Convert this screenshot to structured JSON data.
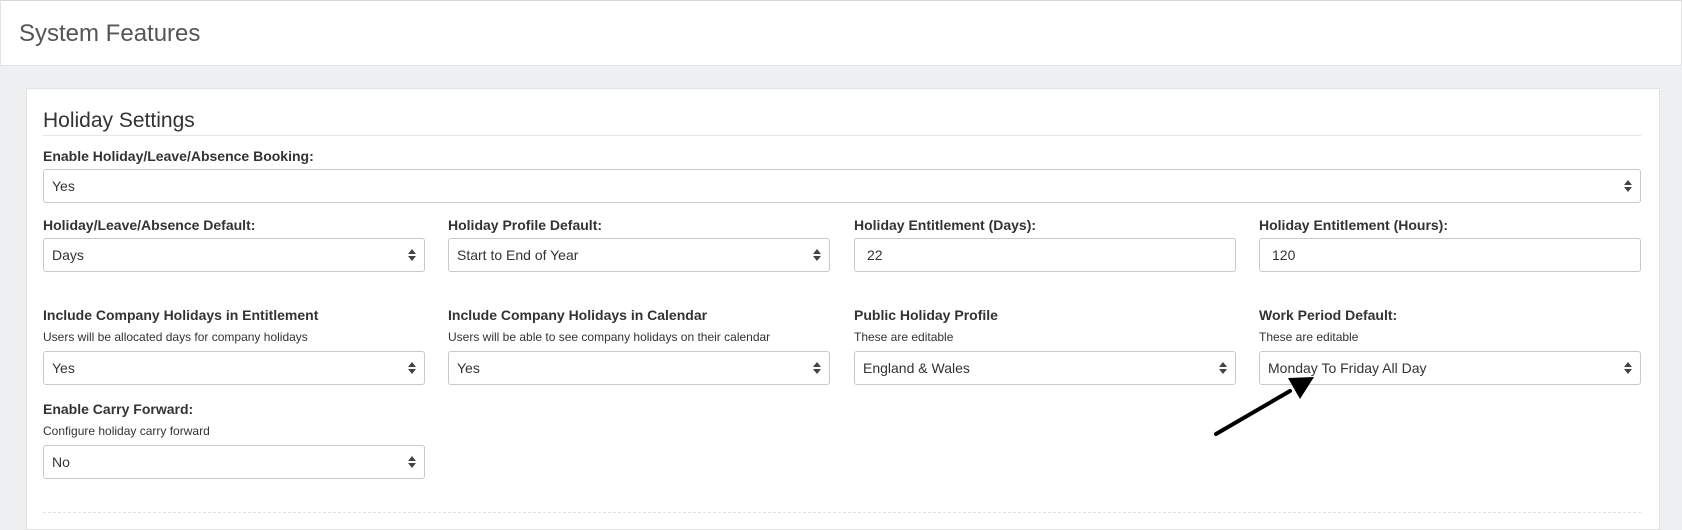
{
  "header": {
    "title": "System Features"
  },
  "section": {
    "title": "Holiday Settings"
  },
  "fields": {
    "enable_booking": {
      "label": "Enable Holiday/Leave/Absence Booking:",
      "value": "Yes"
    },
    "absence_default": {
      "label": "Holiday/Leave/Absence Default:",
      "value": "Days"
    },
    "profile_default": {
      "label": "Holiday Profile Default:",
      "value": "Start to End of Year"
    },
    "entitlement_days": {
      "label": "Holiday Entitlement (Days):",
      "value": "22"
    },
    "entitlement_hours": {
      "label": "Holiday Entitlement (Hours):",
      "value": "120"
    },
    "include_company_entitlement": {
      "label": "Include Company Holidays in Entitlement",
      "help": "Users will be allocated days for company holidays",
      "value": "Yes"
    },
    "include_company_calendar": {
      "label": "Include Company Holidays in Calendar",
      "help": "Users will be able to see company holidays on their calendar",
      "value": "Yes"
    },
    "public_holiday_profile": {
      "label": "Public Holiday Profile",
      "help": "These are editable",
      "value": "England & Wales"
    },
    "work_period_default": {
      "label": "Work Period Default:",
      "help": "These are editable",
      "value": "Monday To Friday All Day"
    },
    "carry_forward": {
      "label": "Enable Carry Forward:",
      "help": "Configure holiday carry forward",
      "value": "No"
    }
  },
  "colors": {
    "background": "#eff0f2",
    "panel": "#ffffff",
    "border": "#c9c9c9",
    "text": "#333333",
    "annotation_arrow": "#000000"
  },
  "icons": {
    "select_caret": "updown-caret-icon",
    "annotation": "annotation-arrow-icon"
  }
}
